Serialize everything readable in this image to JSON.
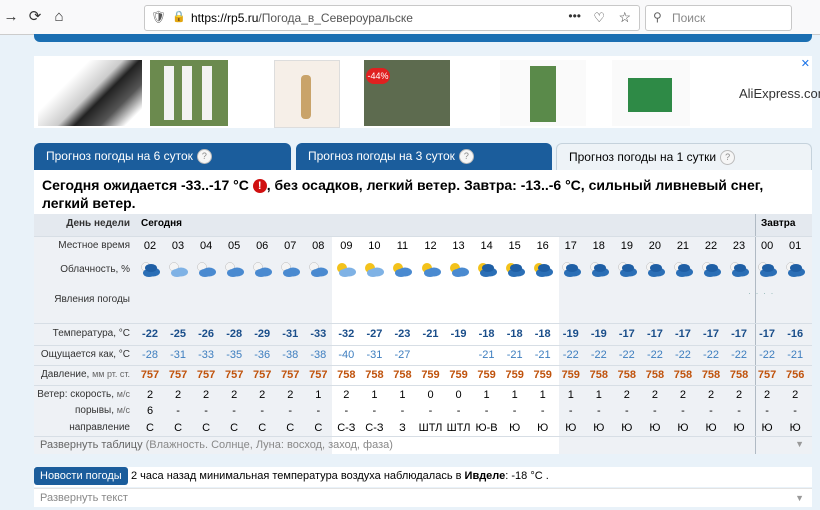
{
  "browser": {
    "url_domain": "https://rp5.ru",
    "url_path": "/Погода_в_Североуральске",
    "search_placeholder": "Поиск",
    "menu_dots": "•••"
  },
  "ads": {
    "aliexpress": "AliExpress.com",
    "discount": "-44%"
  },
  "tabs": [
    "Прогноз погоды на 6 суток",
    "Прогноз погоды на 3 суток",
    "Прогноз погоды на 1 сутки"
  ],
  "help_mark": "?",
  "headline_a": "Сегодня ожидается -33..-17 °C",
  "headline_b": ", без осадков, легкий ветер. Завтра: -13..-6 °C, сильный ливневый снег, легкий ветер.",
  "warn_mark": "!",
  "table": {
    "labels": {
      "day": "День недели",
      "time": "Местное время",
      "cloud": "Облачность, %",
      "phen": "Явления погоды",
      "temp": "Температура, °C",
      "feels": "Ощущается как, °C",
      "pres": "Давление,",
      "pres_unit": "мм рт. ст.",
      "wind": "Ветер: скорость,",
      "wind_unit": "м/с",
      "gust": "порывы,",
      "gust_unit": "м/с",
      "dir": "направление"
    },
    "today": "Сегодня",
    "tomorrow": "Завтра",
    "hours": [
      "02",
      "03",
      "04",
      "05",
      "06",
      "07",
      "08",
      "09",
      "10",
      "11",
      "12",
      "13",
      "14",
      "15",
      "16",
      "17",
      "18",
      "19",
      "20",
      "21",
      "22",
      "23",
      "00",
      "01"
    ],
    "temp": [
      "-22",
      "-25",
      "-26",
      "-28",
      "-29",
      "-31",
      "-33",
      "-32",
      "-27",
      "-23",
      "-21",
      "-19",
      "-18",
      "-18",
      "-18",
      "-19",
      "-19",
      "-17",
      "-17",
      "-17",
      "-17",
      "-17",
      "-17",
      "-16"
    ],
    "feels": [
      "-28",
      "-31",
      "-33",
      "-35",
      "-36",
      "-38",
      "-38",
      "-40",
      "-31",
      "-27",
      "",
      "",
      "-21",
      "-21",
      "-21",
      "-22",
      "-22",
      "-22",
      "-22",
      "-22",
      "-22",
      "-22",
      "-22",
      "-21"
    ],
    "pres": [
      "757",
      "757",
      "757",
      "757",
      "757",
      "757",
      "757",
      "758",
      "758",
      "758",
      "759",
      "759",
      "759",
      "759",
      "759",
      "759",
      "758",
      "758",
      "758",
      "758",
      "758",
      "758",
      "757",
      "756"
    ],
    "wind": [
      "2",
      "2",
      "2",
      "2",
      "2",
      "2",
      "1",
      "2",
      "1",
      "1",
      "0",
      "0",
      "1",
      "1",
      "1",
      "1",
      "1",
      "2",
      "2",
      "2",
      "2",
      "2",
      "2",
      "2"
    ],
    "gust": [
      "6",
      "-",
      "-",
      "-",
      "-",
      "-",
      "-",
      "-",
      "-",
      "-",
      "-",
      "-",
      "-",
      "-",
      "-",
      "-",
      "-",
      "-",
      "-",
      "-",
      "-",
      "-",
      "-",
      "-"
    ],
    "dir": [
      "С",
      "С",
      "С",
      "С",
      "С",
      "С",
      "С",
      "С-З",
      "С-З",
      "З",
      "ШТЛ",
      "ШТЛ",
      "Ю-В",
      "Ю",
      "Ю",
      "Ю",
      "Ю",
      "Ю",
      "Ю",
      "Ю",
      "Ю",
      "Ю",
      "Ю",
      "Ю"
    ],
    "cloud_icons": [
      "overcast-night",
      "partly-cloudy-night",
      "cloudy-night",
      "cloudy-night",
      "cloudy-night",
      "cloudy-night",
      "cloudy-night",
      "partly-cloudy-day",
      "partly-cloudy-day",
      "cloudy-day",
      "cloudy-day",
      "cloudy-day",
      "overcast-day",
      "overcast-day",
      "overcast-day",
      "overcast-night",
      "overcast-night",
      "overcast-night",
      "overcast-night",
      "overcast-night",
      "overcast-night",
      "overcast-night",
      "overcast-night",
      "overcast-night"
    ]
  },
  "expand_table": "Развернуть таблицу",
  "expand_table_extra": "(Влажность. Солнце, Луна: восход, заход, фаза)",
  "news_button": "Новости погоды",
  "news_text_a": "2 часа назад минимальная температура воздуха наблюдалась в ",
  "news_text_b": "Ивделе",
  "news_text_c": ": -18 °С .",
  "expand_text": "Развернуть текст",
  "colors": {
    "tab_blue": "#1b5d9c",
    "temp_blue": "#1a4e8a",
    "pressure_orange": "#c0530d"
  }
}
